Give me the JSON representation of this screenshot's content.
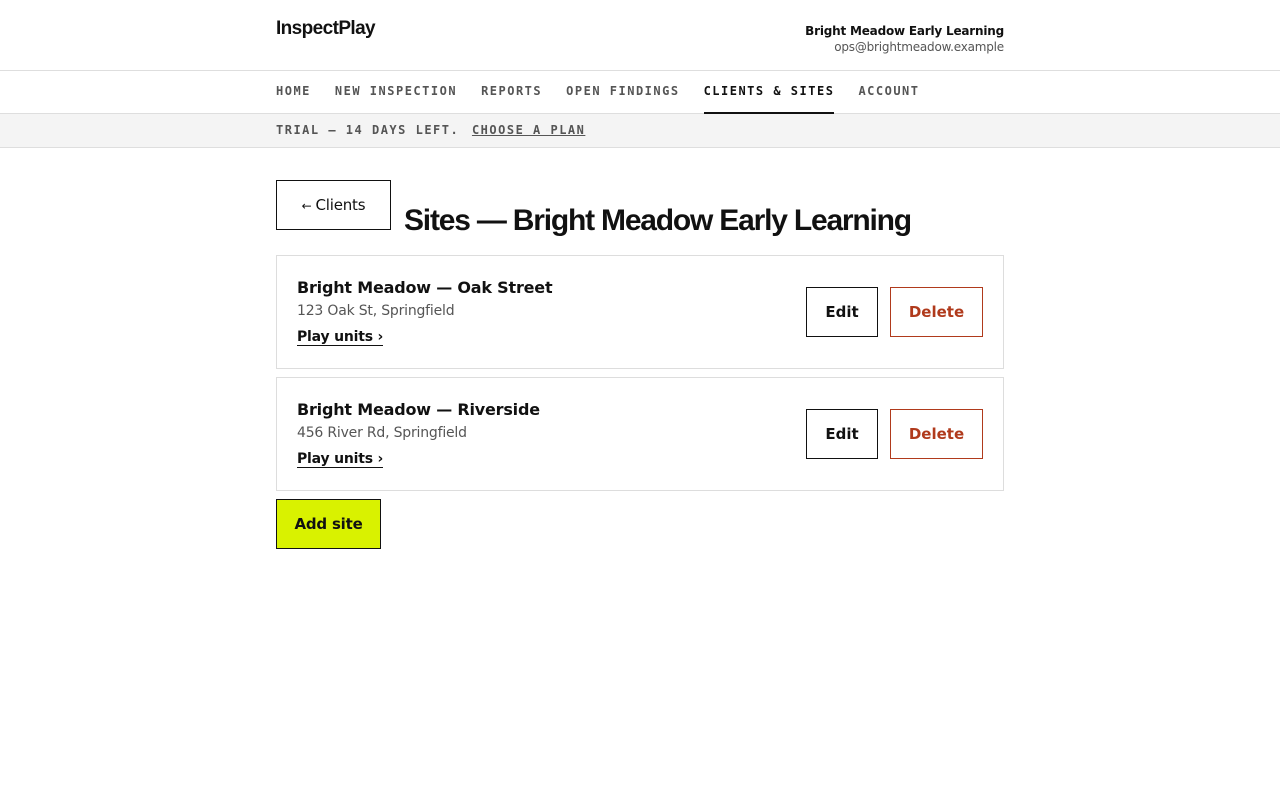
{
  "app": {
    "logo": "InspectPlay",
    "org_name": "Bright Meadow Early Learning",
    "org_email": "ops@brightmeadow.example"
  },
  "nav": {
    "items": [
      {
        "label": "HOME",
        "active": false
      },
      {
        "label": "NEW INSPECTION",
        "active": false
      },
      {
        "label": "REPORTS",
        "active": false
      },
      {
        "label": "OPEN FINDINGS",
        "active": false
      },
      {
        "label": "CLIENTS & SITES",
        "active": true
      },
      {
        "label": "ACCOUNT",
        "active": false
      }
    ]
  },
  "banner": {
    "text": "TRIAL — 14 DAYS LEFT.",
    "link": "CHOOSE A PLAN"
  },
  "main": {
    "back_label": "Clients",
    "back_arrow": "←",
    "title": "Sites — Bright Meadow Early Learning",
    "sites": [
      {
        "name": "Bright Meadow — Oak Street",
        "address": "123 Oak St, Springfield",
        "link": "Play units ›",
        "edit": "Edit",
        "delete": "Delete"
      },
      {
        "name": "Bright Meadow — Riverside",
        "address": "456 River Rd, Springfield",
        "link": "Play units ›",
        "edit": "Edit",
        "delete": "Delete"
      }
    ],
    "add_label": "Add site"
  },
  "colors": {
    "accent": "#d9f200",
    "danger": "#b03a1c",
    "text": "#111111",
    "muted": "#555555"
  }
}
